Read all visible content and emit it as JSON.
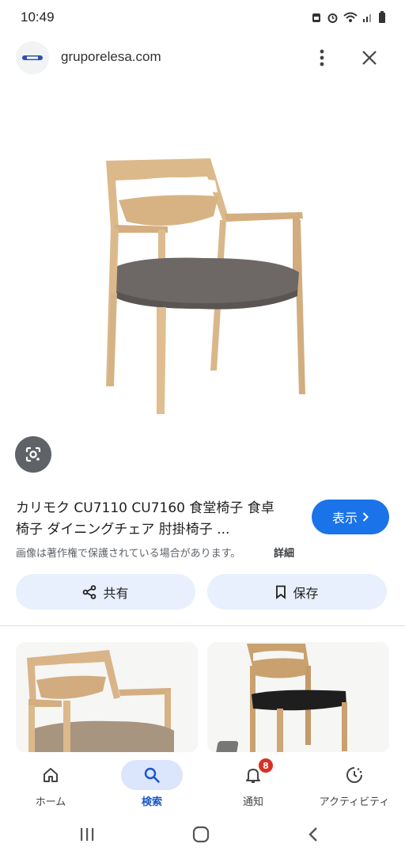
{
  "status_bar": {
    "time": "10:49",
    "icons": [
      "save-icon",
      "alarm-icon",
      "wifi-icon",
      "signal-icon",
      "battery-icon"
    ]
  },
  "header": {
    "site_name": "gruporelesa.com",
    "favicon": "site-logo-icon",
    "menu_icon": "more-vert-icon",
    "close_icon": "close-icon"
  },
  "image": {
    "description_icon": "chair-image",
    "lens_icon": "google-lens-icon"
  },
  "result": {
    "title_line1": "カリモク CU7110 CU7160 食堂椅子 食卓",
    "title_line2": "椅子 ダイニングチェア 肘掛椅子 ...",
    "visit_label": "表示",
    "copyright_notice": "画像は著作権で保護されている場合があります。",
    "details_label": "詳細"
  },
  "actions": {
    "share_label": "共有",
    "save_label": "保存"
  },
  "bottom_nav": {
    "items": [
      {
        "label": "ホーム",
        "icon": "home-icon"
      },
      {
        "label": "検索",
        "icon": "search-icon"
      },
      {
        "label": "通知",
        "icon": "bell-icon",
        "badge": "8"
      },
      {
        "label": "アクティビティ",
        "icon": "activity-icon"
      }
    ]
  },
  "colors": {
    "accent": "#1a73e8",
    "chip_bg": "#e8f0fe",
    "badge": "#d93025"
  }
}
